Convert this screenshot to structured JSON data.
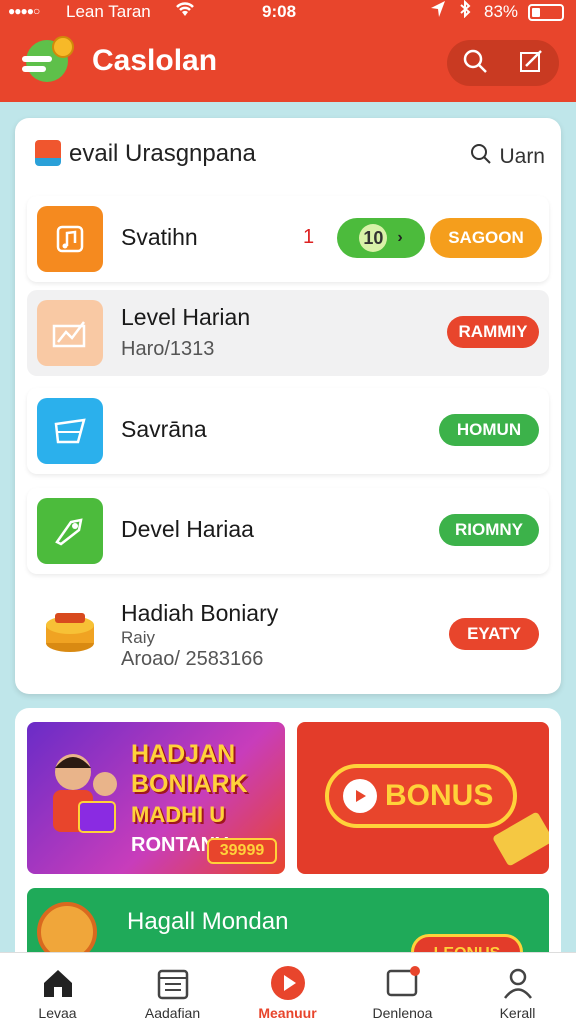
{
  "status_bar": {
    "carrier": "Lean Taran",
    "time": "9:08",
    "battery": "83%",
    "battery_level": 0.25
  },
  "app_bar": {
    "title": "Caslolan",
    "icons": [
      "search-icon",
      "edit-icon"
    ]
  },
  "card": {
    "title": "evail Urasgnpana",
    "link_label": "Uarn",
    "rows": [
      {
        "name": "Svatihn",
        "count": "1",
        "toggle_value": "10",
        "action": "SAGOON",
        "icon": "music-icon",
        "color": "#f58a1f"
      },
      {
        "name": "Level Harian",
        "sub": "Haro/1313",
        "action": "RAMMIY",
        "icon": "chart-icon",
        "color": "#f9c9a4"
      },
      {
        "name": "Savrāna",
        "action": "HOMUN",
        "icon": "ticket-icon",
        "color": "#2bb0ec"
      },
      {
        "name": "Devel Hariaa",
        "action": "RIOMNY",
        "icon": "rocket-icon",
        "color": "#4cbb3c"
      },
      {
        "name": "Hadiah Boniary",
        "sub": "Raiy",
        "sub2": "Aroao/ 2583166",
        "action": "EYATY",
        "icon": "coins-icon"
      }
    ]
  },
  "banners": {
    "b1_lines": [
      "HADJAN",
      "BONIARK",
      "MADHI U",
      "RONTANY"
    ],
    "b1_badge": "39999",
    "b2_label": "BONUS",
    "b3_title": "Hagall Mondan",
    "b3_button": "LEONUS"
  },
  "nav": [
    {
      "label": "Levaa",
      "icon": "home-icon"
    },
    {
      "label": "Aadafian",
      "icon": "calendar-icon"
    },
    {
      "label": "Meanuur",
      "icon": "play-icon",
      "active": true
    },
    {
      "label": "Denlenoa",
      "icon": "chat-icon"
    },
    {
      "label": "Kerall",
      "icon": "profile-icon"
    }
  ],
  "colors": {
    "brand": "#e8452c",
    "green": "#3cb24a",
    "orange": "#f59e1c"
  }
}
